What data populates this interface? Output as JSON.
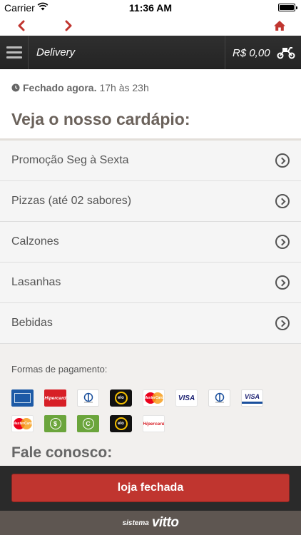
{
  "status_bar": {
    "carrier": "Carrier",
    "time": "11:36 AM"
  },
  "nav": {
    "back_icon": "chevron-left-icon",
    "forward_icon": "chevron-right-icon",
    "home_icon": "home-icon",
    "accent_color": "#c0352f"
  },
  "header": {
    "title": "Delivery",
    "cart_total": "R$ 0,00",
    "delivery_icon": "scooter-icon"
  },
  "hours": {
    "status": "Fechado agora.",
    "schedule": "17h às 23h"
  },
  "page_title": "Veja o nosso cardápio:",
  "menu": {
    "items": [
      {
        "label": "Promoção Seg à Sexta"
      },
      {
        "label": "Pizzas (até 02 sabores)"
      },
      {
        "label": "Calzones"
      },
      {
        "label": "Lasanhas"
      },
      {
        "label": "Bebidas"
      }
    ]
  },
  "payments": {
    "title": "Formas de pagamento:",
    "methods": [
      {
        "name": "amex-card-icon"
      },
      {
        "name": "hipercard-card-icon",
        "text": "Hipercard"
      },
      {
        "name": "diners-card-icon"
      },
      {
        "name": "elo-card-icon",
        "text": "elo"
      },
      {
        "name": "mastercard-card-icon",
        "text": "MasterCard"
      },
      {
        "name": "visa-card-icon",
        "text": "VISA"
      },
      {
        "name": "diners-card-icon"
      },
      {
        "name": "visa-electron-card-icon",
        "text": "VISA"
      },
      {
        "name": "mastercard-card-icon",
        "text": "MasterCard"
      },
      {
        "name": "cash-icon",
        "text": "$"
      },
      {
        "name": "voucher-icon",
        "text": "C"
      },
      {
        "name": "elo-card-icon",
        "text": "elo"
      },
      {
        "name": "hipercard-card-icon",
        "text": "Hipercard"
      }
    ]
  },
  "contact_title": "Fale conosco:",
  "footer": {
    "status_button": "loja fechada",
    "brand_prefix": "sistema",
    "brand_name": "vitto"
  },
  "colors": {
    "header_bg": "#2a2a2a",
    "button_red": "#c0352f",
    "brand_bar": "#5e5651",
    "page_bg": "#f2f0ee"
  }
}
